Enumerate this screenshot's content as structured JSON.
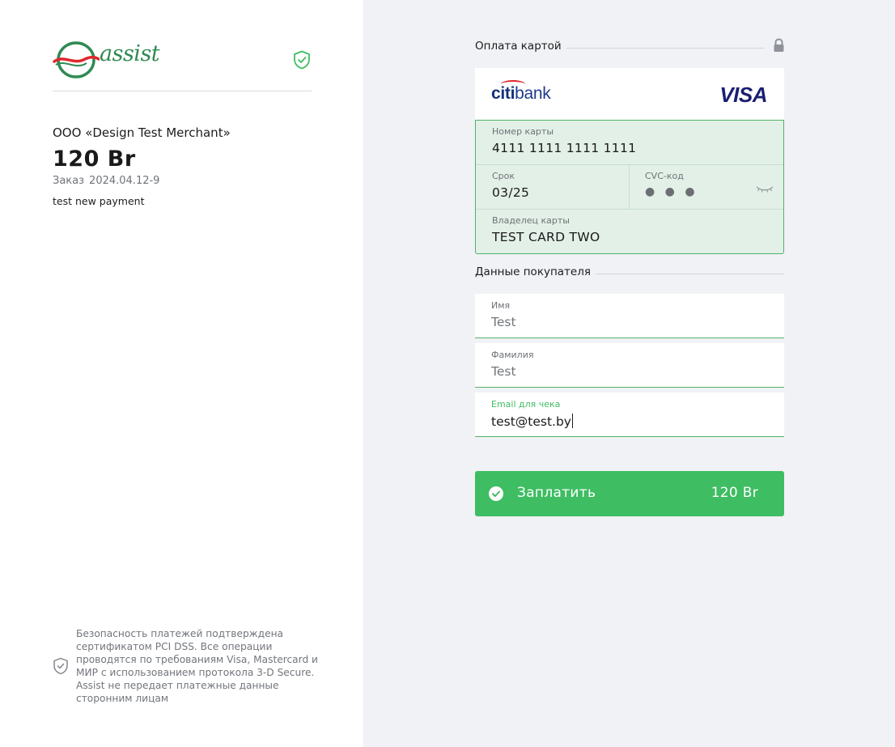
{
  "brand": {
    "logo_text": "assist",
    "accent": "#3ebd62"
  },
  "order": {
    "merchant": "ООО «Design Test Merchant»",
    "amount": "120 Br",
    "order_label": "Заказ",
    "order_number": "2024.04.12-9",
    "description": "test new payment"
  },
  "security_note": "Безопасность платежей подтверждена сертификатом PCI DSS. Все операции проводятся по требованиям Visa, Mastercard и МИР с использованием протокола 3-D Secure. Assist не передает платежные данные сторонним лицам",
  "card_section": {
    "title": "Оплата картой",
    "bank_prefix": "citi",
    "bank_suffix": "bank",
    "network": "VISA",
    "number_label": "Номер карты",
    "number_value": "4111  1111  1111  1111",
    "expiry_label": "Срок",
    "expiry_value": "03/25",
    "cvc_label": "CVC-код",
    "cvc_value": "● ● ●",
    "holder_label": "Владелец карты",
    "holder_value": "TEST CARD TWO"
  },
  "buyer_section": {
    "title": "Данные покупателя",
    "first_name_label": "Имя",
    "first_name_value": "Test",
    "last_name_label": "Фамилия",
    "last_name_value": "Test",
    "email_label": "Email для чека",
    "email_value": "test@test.by"
  },
  "pay_button": {
    "label": "Заплатить",
    "amount": "120 Br"
  }
}
